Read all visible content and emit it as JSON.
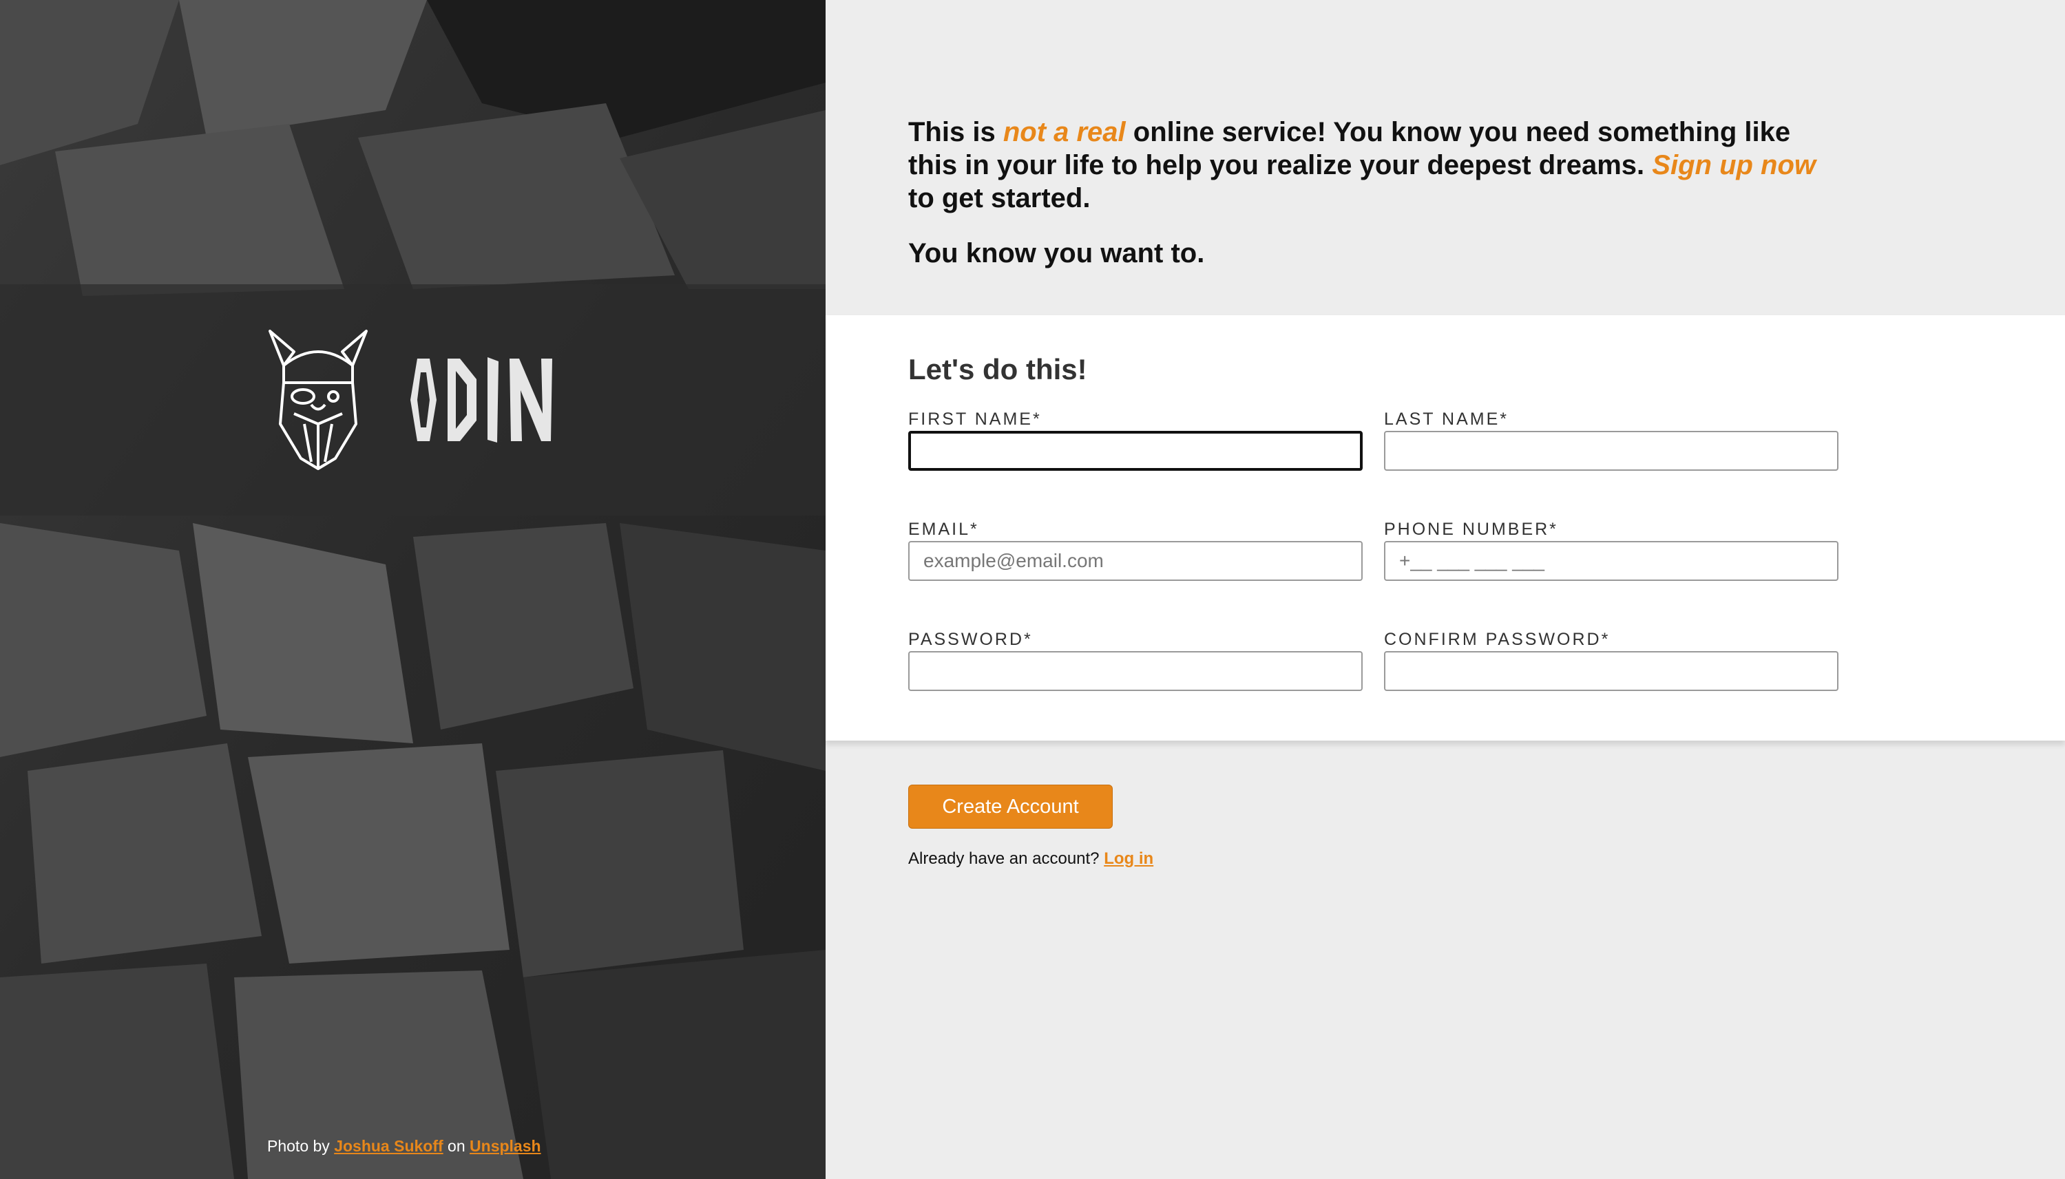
{
  "colors": {
    "accent": "#e8871a",
    "panel_bg": "#ededed",
    "card_bg": "#ffffff",
    "text": "#111111"
  },
  "brand": {
    "logo_icon": "viking-helmet-icon",
    "wordmark": "ODIN"
  },
  "credit": {
    "prefix": "Photo by",
    "author": "Joshua Sukoff",
    "middle": "on",
    "site": "Unsplash"
  },
  "intro": {
    "p1_part1": "This is",
    "p1_accent1": "not a real",
    "p1_part2": "online service! You know you need something like this in your life to help you realize your deepest dreams.",
    "p1_accent2": "Sign up now",
    "p1_part3": "to get started.",
    "p2": "You know you want to."
  },
  "form": {
    "heading": "Let's do this!",
    "fields": {
      "first_name": {
        "label": "FIRST NAME*",
        "value": "",
        "placeholder": ""
      },
      "last_name": {
        "label": "LAST NAME*",
        "value": "",
        "placeholder": ""
      },
      "email": {
        "label": "EMAIL*",
        "value": "",
        "placeholder": "example@email.com"
      },
      "phone": {
        "label": "PHONE NUMBER*",
        "value": "",
        "placeholder": "+__ ___ ___ ___"
      },
      "password": {
        "label": "PASSWORD*",
        "value": "",
        "placeholder": ""
      },
      "confirm_password": {
        "label": "CONFIRM PASSWORD*",
        "value": "",
        "placeholder": ""
      }
    }
  },
  "actions": {
    "create_label": "Create Account",
    "login_prompt": "Already have an account?",
    "login_link": "Log in"
  }
}
